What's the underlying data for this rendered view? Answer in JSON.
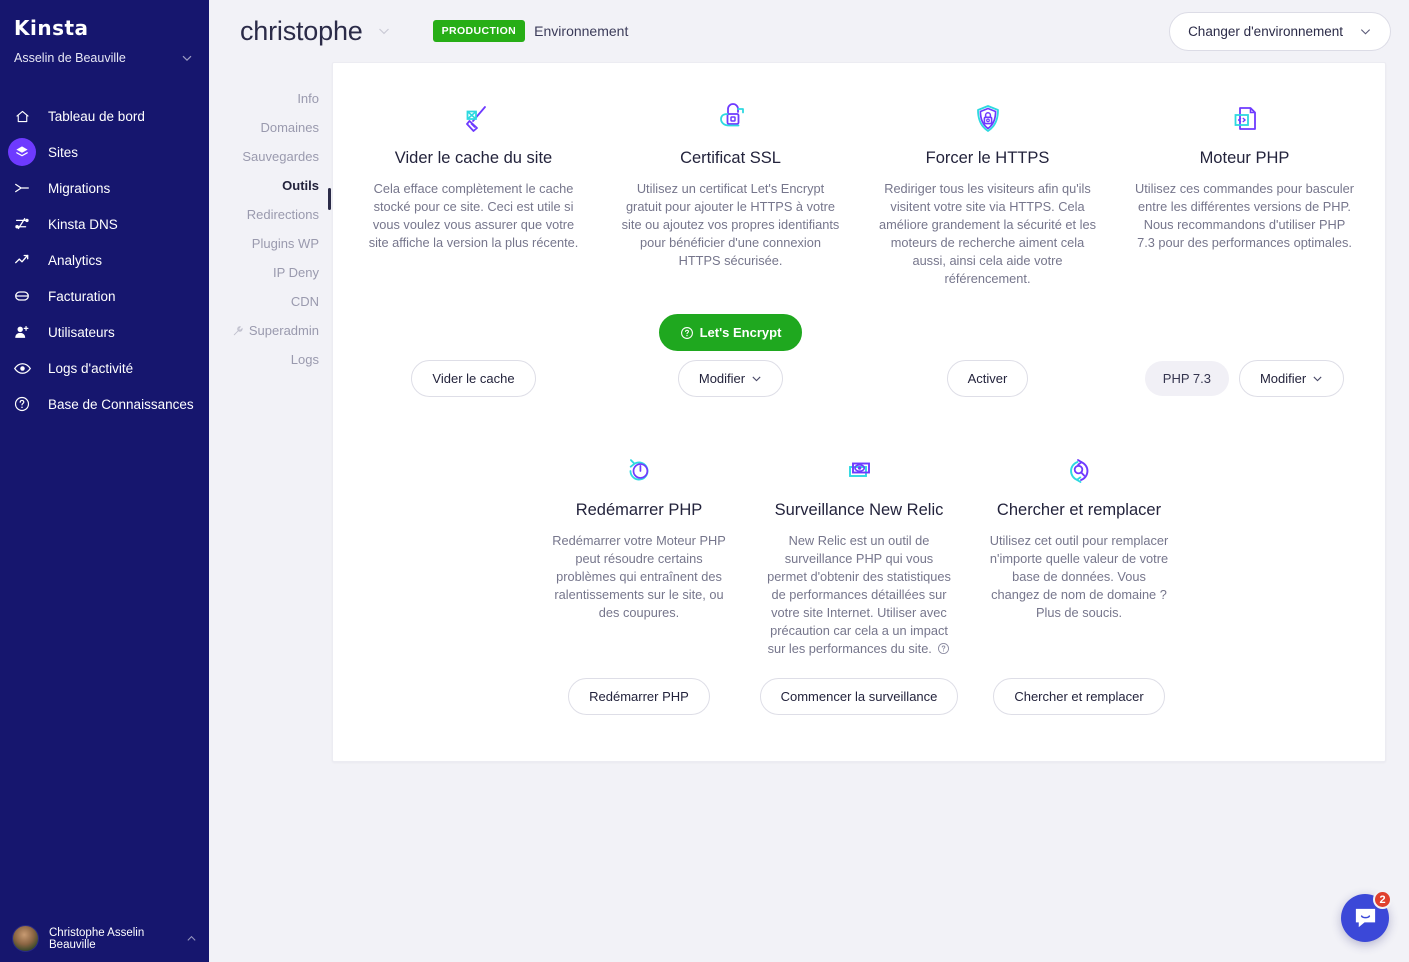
{
  "sidebar": {
    "logo": "Kinsta",
    "account": "Asselin de Beauville",
    "items": [
      {
        "label": "Tableau de bord",
        "icon": "home-icon",
        "active": false
      },
      {
        "label": "Sites",
        "icon": "layers-icon",
        "active": true
      },
      {
        "label": "Migrations",
        "icon": "migrations-icon",
        "active": false
      },
      {
        "label": "Kinsta DNS",
        "icon": "dns-icon",
        "active": false
      },
      {
        "label": "Analytics",
        "icon": "analytics-icon",
        "active": false
      },
      {
        "label": "Facturation",
        "icon": "billing-icon",
        "active": false
      },
      {
        "label": "Utilisateurs",
        "icon": "user-plus-icon",
        "active": false
      },
      {
        "label": "Logs d'activité",
        "icon": "eye-icon",
        "active": false
      },
      {
        "label": "Base de Connaissances",
        "icon": "help-circle-icon",
        "active": false
      }
    ],
    "user": "Christophe Asselin Beauville"
  },
  "header": {
    "site_name": "christophe",
    "env_badge": "PRODUCTION",
    "env_label": "Environnement",
    "switch_env": "Changer d'environnement"
  },
  "subnav": {
    "items": [
      {
        "label": "Info",
        "active": false,
        "icon": null
      },
      {
        "label": "Domaines",
        "active": false,
        "icon": null
      },
      {
        "label": "Sauvegardes",
        "active": false,
        "icon": null
      },
      {
        "label": "Outils",
        "active": true,
        "icon": null
      },
      {
        "label": "Redirections",
        "active": false,
        "icon": null
      },
      {
        "label": "Plugins WP",
        "active": false,
        "icon": null
      },
      {
        "label": "IP Deny",
        "active": false,
        "icon": null
      },
      {
        "label": "CDN",
        "active": false,
        "icon": null
      },
      {
        "label": "Superadmin",
        "active": false,
        "icon": "wrench-icon"
      },
      {
        "label": "Logs",
        "active": false,
        "icon": null
      }
    ]
  },
  "tools_row1": [
    {
      "icon": "broom-icon",
      "title": "Vider le cache du site",
      "desc": "Cela efface complètement le cache stocké pour ce site. Ceci est utile si vous voulez vous assurer que votre site affiche la version la plus récente.",
      "primary_btn": "Vider le cache"
    },
    {
      "icon": "unlocked-padlock-icon",
      "title": "Certificat SSL",
      "desc": "Utilisez un certificat Let's Encrypt gratuit pour ajouter le HTTPS à votre site ou ajoutez vos propres identifiants pour bénéficier d'une connexion HTTPS sécurisée.",
      "green_btn": "Let's Encrypt",
      "secondary_btn": "Modifier"
    },
    {
      "icon": "shield-lock-icon",
      "title": "Forcer le HTTPS",
      "desc": "Rediriger tous les visiteurs afin qu'ils visitent votre site via HTTPS. Cela améliore grandement la sécurité et les moteurs de recherche aiment cela aussi, ainsi cela aide votre référencement.",
      "primary_btn": "Activer"
    },
    {
      "icon": "code-file-icon",
      "title": "Moteur PHP",
      "desc": "Utilisez ces commandes pour basculer entre les différentes versions de PHP. Nous recommandons d'utiliser PHP 7.3 pour des performances optimales.",
      "version_pill": "PHP 7.3",
      "secondary_btn": "Modifier"
    }
  ],
  "tools_row2": [
    {
      "icon": "restart-power-icon",
      "title": "Redémarrer PHP",
      "desc": "Redémarrer votre Moteur PHP peut résoudre certains problèmes qui entraînent des ralentissements sur le site, ou des coupures.",
      "primary_btn": "Redémarrer PHP"
    },
    {
      "icon": "monitor-eye-icon",
      "title": "Surveillance New Relic",
      "desc": "New Relic est un outil de surveillance PHP qui vous permet d'obtenir des statistiques de performances détaillées sur votre site Internet. Utiliser avec précaution car cela a un impact sur les performances du site.",
      "desc_help_icon": true,
      "primary_btn": "Commencer la surveillance"
    },
    {
      "icon": "search-replace-icon",
      "title": "Chercher et remplacer",
      "desc": "Utilisez cet outil pour remplacer n'importe quelle valeur de votre base de données. Vous changez de nom de domaine ? Plus de soucis.",
      "primary_btn": "Chercher et remplacer"
    }
  ],
  "intercom": {
    "badge_count": "2"
  },
  "colors": {
    "sidebar_bg": "#16166E",
    "accent_purple": "#6E3AFF",
    "accent_cyan": "#2ED9E0",
    "green": "#1FA81F",
    "badge_green": "#27AE16",
    "page_bg": "#F2F2F7",
    "intercom_blue": "#3B48D8",
    "badge_red": "#E0402E"
  }
}
